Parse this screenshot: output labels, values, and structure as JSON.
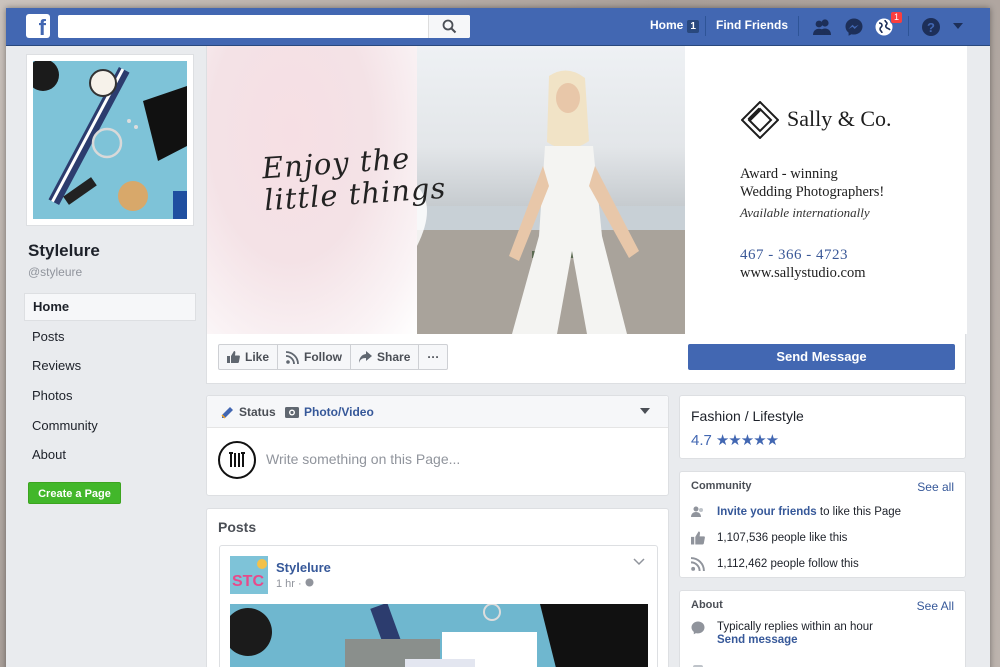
{
  "topbar": {
    "search_placeholder": "",
    "home_label": "Home",
    "home_count": "1",
    "find_friends_label": "Find Friends",
    "notification_count": "1"
  },
  "page": {
    "name": "Stylelure",
    "handle": "@styleure"
  },
  "sidebar": {
    "items": [
      {
        "label": "Home",
        "active": true
      },
      {
        "label": "Posts"
      },
      {
        "label": "Reviews"
      },
      {
        "label": "Photos"
      },
      {
        "label": "Community"
      },
      {
        "label": "About"
      }
    ],
    "create_page_label": "Create a Page"
  },
  "cover": {
    "script_line1": "Enjoy the",
    "script_line2": "little things",
    "brand_name": "Sally & Co.",
    "award_line1": "Award - winning",
    "award_line2": "Wedding Photographers!",
    "availability": "Available internationally",
    "phone": "467 - 366 - 4723",
    "website": "www.sallystudio.com"
  },
  "actions": {
    "like": "Like",
    "follow": "Follow",
    "share": "Share",
    "more": "···",
    "send_message": "Send Message"
  },
  "composer": {
    "status_tab": "Status",
    "photo_tab": "Photo/Video",
    "placeholder": "Write something on this Page..."
  },
  "posts": {
    "title": "Posts",
    "author": "Stylelure",
    "time": "1 hr ·"
  },
  "info": {
    "category": "Fashion / Lifestyle",
    "rating": "4.7",
    "stars": "★★★★★"
  },
  "community": {
    "title": "Community",
    "see_all": "See all",
    "invite_link": "Invite your friends",
    "invite_rest": "to like this Page",
    "likes_text": "1,107,536 people like this",
    "follows_text": "1,112,462 people follow this"
  },
  "about": {
    "title": "About",
    "see_all": "See All",
    "reply_text": "Typically replies within an hour",
    "send_link": "Send message"
  },
  "colors": {
    "brand_blue": "#4267b2",
    "link_blue": "#365899",
    "create_green": "#42b72a",
    "badge_red": "#fa3e3e"
  }
}
